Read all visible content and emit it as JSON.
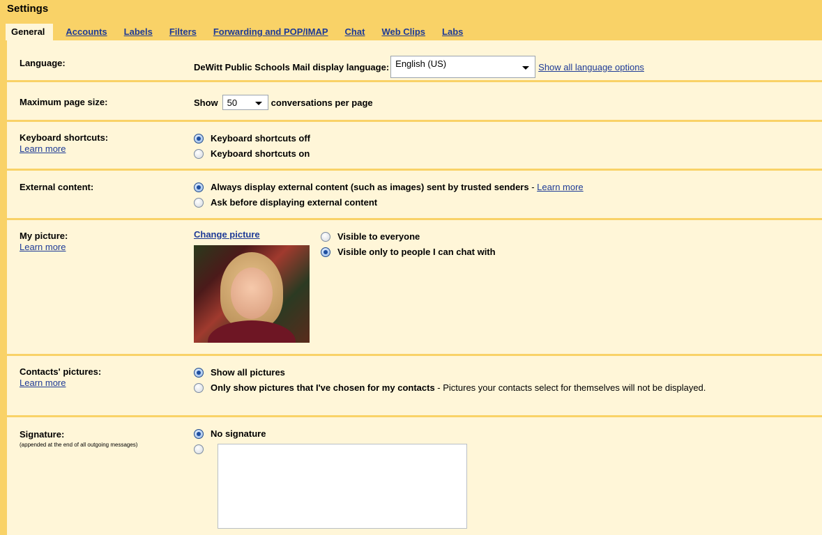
{
  "header": {
    "title": "Settings"
  },
  "tabs": [
    {
      "label": "General",
      "active": true
    },
    {
      "label": "Accounts"
    },
    {
      "label": "Labels"
    },
    {
      "label": "Filters"
    },
    {
      "label": "Forwarding and POP/IMAP"
    },
    {
      "label": "Chat"
    },
    {
      "label": "Web Clips"
    },
    {
      "label": "Labs"
    }
  ],
  "language": {
    "label": "Language:",
    "prefix": "DeWitt Public Schools Mail display language:",
    "selected": "English (US)",
    "show_all": "Show all language options"
  },
  "page_size": {
    "label": "Maximum page size:",
    "show": "Show",
    "value": "50",
    "suffix": "conversations per page"
  },
  "shortcuts": {
    "label": "Keyboard shortcuts:",
    "learn_more": "Learn more",
    "off": "Keyboard shortcuts off",
    "on": "Keyboard shortcuts on"
  },
  "external": {
    "label": "External content:",
    "always": "Always display external content (such as images) sent by trusted senders",
    "sep": " - ",
    "learn_more": "Learn more",
    "ask": "Ask before displaying external content"
  },
  "picture": {
    "label": "My picture:",
    "learn_more": "Learn more",
    "change": "Change picture",
    "everyone": "Visible to everyone",
    "chat_only": "Visible only to people I can chat with"
  },
  "contacts": {
    "label": "Contacts' pictures:",
    "learn_more": "Learn more",
    "show_all": "Show all pictures",
    "only_mine": "Only show pictures that I've chosen for my contacts",
    "only_mine_note": " - Pictures your contacts select for themselves will not be displayed."
  },
  "signature": {
    "label": "Signature:",
    "sub": "(appended at the end of all outgoing messages)",
    "none": "No signature",
    "text": ""
  }
}
